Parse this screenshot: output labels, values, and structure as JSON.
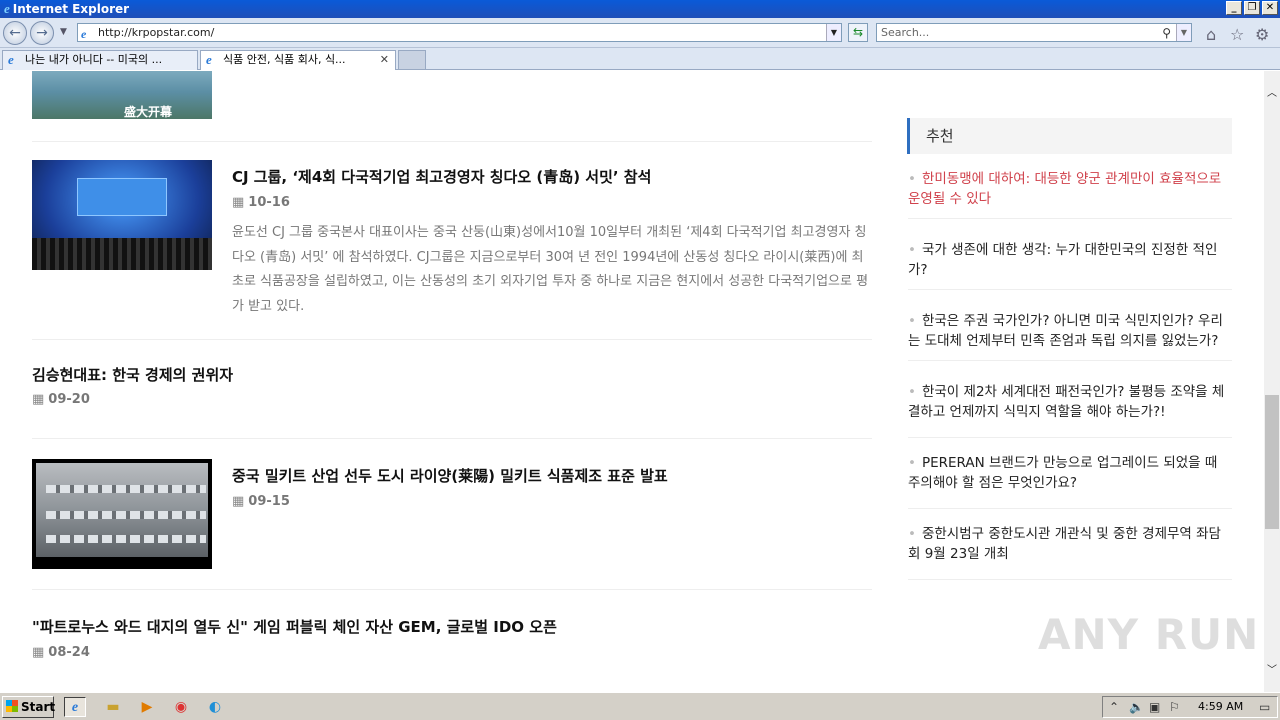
{
  "window": {
    "title": "Internet Explorer"
  },
  "toolbar": {
    "url": "http://krpopstar.com/",
    "search_placeholder": "Search..."
  },
  "tabs": [
    {
      "label": "나는 내가 아니다 -- 미국의 ..."
    },
    {
      "label": "식품 안전, 식품 회사, 식..."
    }
  ],
  "articles": [
    {
      "thumb_text": "盛大开幕"
    },
    {
      "title": "CJ 그룹, ‘제4회 다국적기업 최고경영자 칭다오 (青岛) 서밋’ 참석",
      "date": "10-16",
      "excerpt": "윤도선 CJ 그룹 중국본사 대표이사는 중국 산둥(山東)성에서10월 10일부터 개최된 ‘제4회 다국적기업 최고경영자 칭다오 (青岛) 서밋’ 에 참석하였다. CJ그룹은 지금으로부터 30여 년 전인 1994년에 산동성 칭다오 라이시(莱西)에 최초로 식품공장을 설립하였고, 이는 산동성의 초기 외자기업 투자 중 하나로 지금은 현지에서 성공한 다국적기업으로 평가 받고 있다."
    },
    {
      "title": "김승현대표: 한국 경제의 권위자",
      "date": "09-20"
    },
    {
      "title": "중국 밀키트 산업 선두 도시 라이양(莱陽) 밀키트 식품제조 표준 발표",
      "date": "09-15"
    },
    {
      "title": "\"파트로누스 와드 대지의 열두 신\" 게임 퍼블릭 체인 자산 GEM, 글로벌 IDO 오픈",
      "date": "08-24"
    }
  ],
  "sidebar": {
    "heading": "추천",
    "items": [
      {
        "label": "한미동맹에 대하여: 대등한 양군 관계만이 효율적으로 운영될 수 있다"
      },
      {
        "label": "국가 생존에 대한 생각: 누가 대한민국의 진정한 적인가?"
      },
      {
        "label": "한국은 주권 국가인가? 아니면 미국 식민지인가? 우리는 도대체 언제부터 민족 존엄과 독립 의지를 잃었는가?"
      },
      {
        "label": "한국이 제2차 세계대전 패전국인가? 불평등 조약을 체결하고 언제까지 식믹지 역할을 해야 하는가?!"
      },
      {
        "label": "PERERAN 브랜드가 만능으로 업그레이드 되었을 때 주의해야 할 점은 무엇인가요?"
      },
      {
        "label": "중한시범구 중한도시관 개관식 및 중한 경제무역 좌담회 9월 23일 개최"
      }
    ]
  },
  "watermark": "ANY RUN",
  "taskbar": {
    "start_label": "Start",
    "clock": "4:59 AM"
  }
}
